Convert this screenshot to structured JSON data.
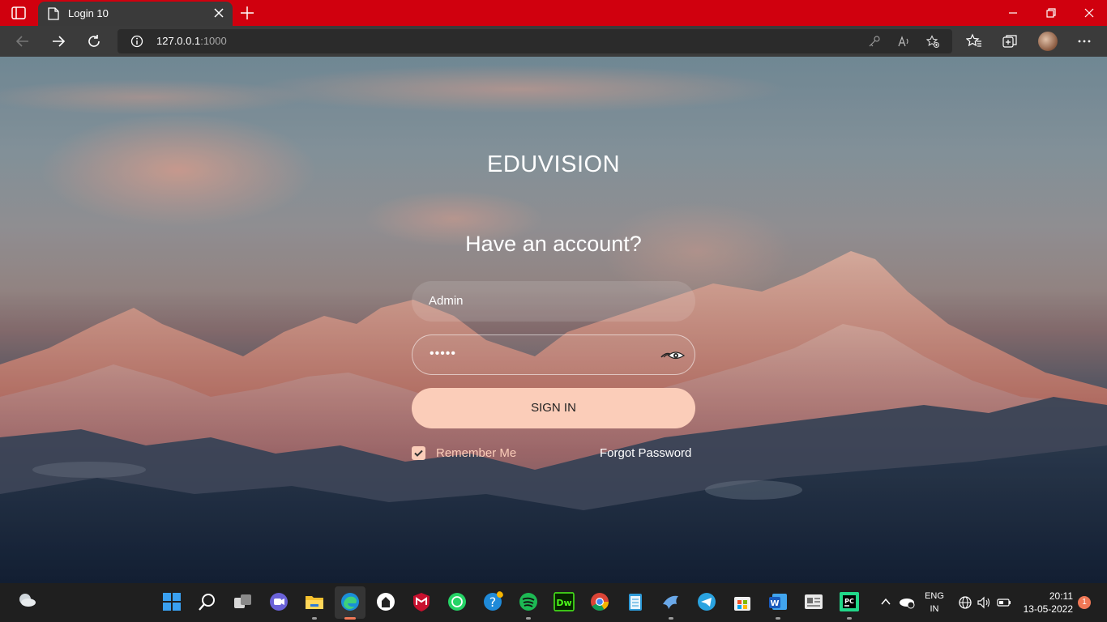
{
  "browser": {
    "tab_title": "Login 10",
    "url_host": "127.0.0.1",
    "url_port": ":1000"
  },
  "page": {
    "brand": "EDUVISION",
    "heading": "Have an account?",
    "username_value": "Admin",
    "password_mask": "•••••",
    "sign_in_label": "SIGN IN",
    "remember_label": "Remember Me",
    "remember_checked": true,
    "forgot_label": "Forgot Password"
  },
  "taskbar": {
    "lang_line1": "ENG",
    "lang_line2": "IN",
    "time": "20:11",
    "date": "13-05-2022",
    "notification_count": "1"
  },
  "colors": {
    "title_bar": "#d0000e",
    "accent_peach": "#fbcdb9",
    "toolbar": "#3b3b3b"
  }
}
